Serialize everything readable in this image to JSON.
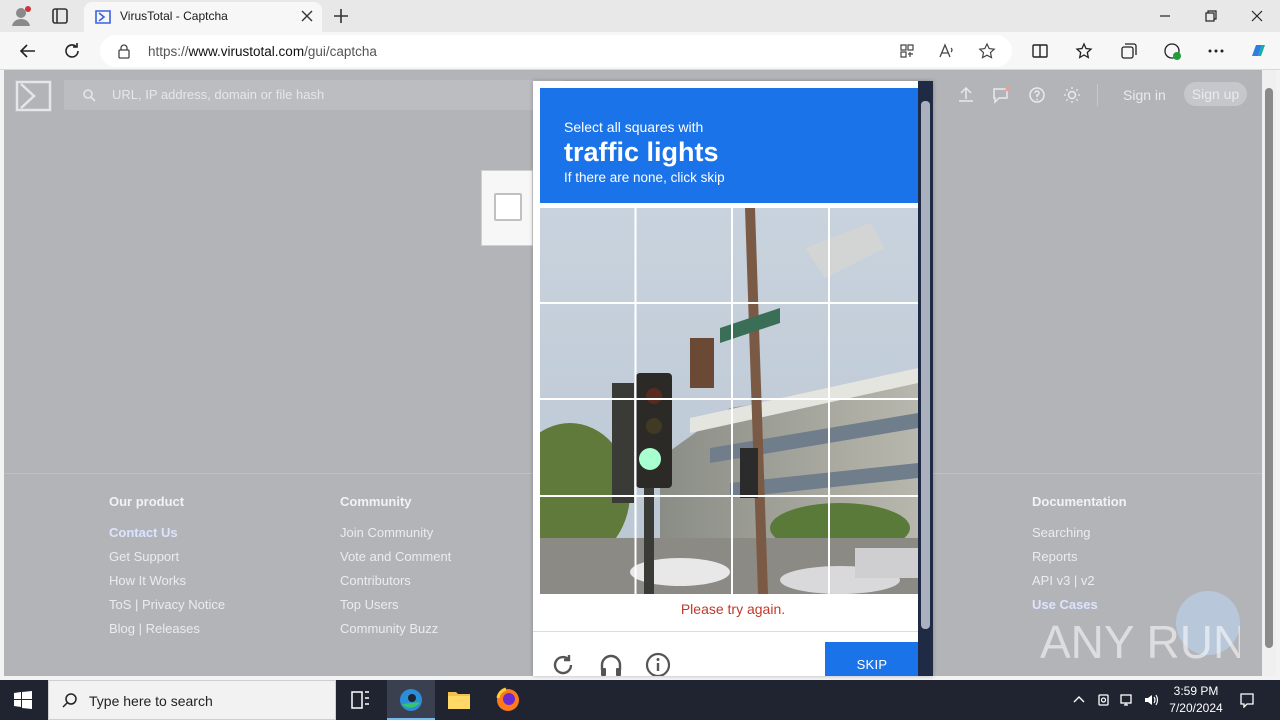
{
  "browser": {
    "tab_title": "VirusTotal - Captcha",
    "url_prefix": "https://",
    "url_domain": "www.virustotal.com",
    "url_path": "/gui/captcha"
  },
  "site": {
    "search_placeholder": "URL, IP address, domain or file hash",
    "sign_in": "Sign in",
    "sign_up": "Sign up"
  },
  "footer": {
    "columns": [
      {
        "title": "Our product",
        "links": [
          "Contact Us",
          "Get Support",
          "How It Works",
          "ToS | Privacy Notice",
          "Blog | Releases"
        ]
      },
      {
        "title": "Community",
        "links": [
          "Join Community",
          "Vote and Comment",
          "Contributors",
          "Top Users",
          "Community Buzz"
        ]
      },
      {
        "title": "Documentation",
        "links": [
          "Searching",
          "Reports",
          "API v3 | v2",
          "Use Cases"
        ]
      }
    ]
  },
  "captcha": {
    "instruction": "Select all squares with",
    "target": "traffic lights",
    "hint": "If there are none, click skip",
    "error": "Please try again.",
    "skip_label": "SKIP"
  },
  "watermark": "ANY RUN",
  "taskbar": {
    "search_placeholder": "Type here to search",
    "time": "3:59 PM",
    "date": "7/20/2024"
  },
  "colors": {
    "accent": "#1a73e8",
    "error": "#c0392b",
    "overlay": "#b3b4b8"
  }
}
